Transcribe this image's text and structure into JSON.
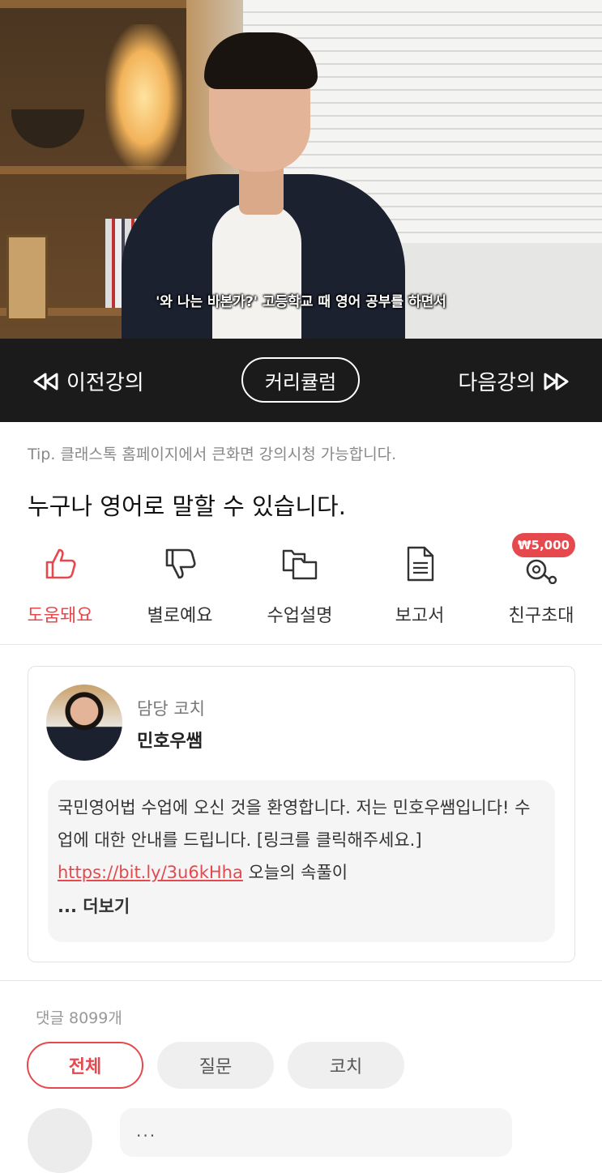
{
  "video": {
    "subtitle": "'와 나는 바본가?' 고등학교 때 영어 공부를 하면서"
  },
  "navbar": {
    "prev_label": "이전강의",
    "curriculum_label": "커리큘럼",
    "next_label": "다음강의"
  },
  "tip": "Tip. 클래스톡 홈페이지에서 큰화면 강의시청 가능합니다.",
  "lesson_title": "누구나 영어로 말할 수 있습니다.",
  "actions": [
    {
      "label": "도움돼요",
      "icon": "thumbs-up-icon"
    },
    {
      "label": "별로예요",
      "icon": "thumbs-down-icon"
    },
    {
      "label": "수업설명",
      "icon": "folders-icon"
    },
    {
      "label": "보고서",
      "icon": "document-icon"
    },
    {
      "label": "친구초대",
      "icon": "invite-icon"
    }
  ],
  "invite_badge": "₩5,000",
  "coach": {
    "role": "담당 코치",
    "name": "민호우쌤",
    "message_before_link": "국민영어법 수업에 오신 것을 환영합니다. 저는 민호우쌤입니다! 수업에 대한 안내를 드립니다. [링크를 클릭해주세요.] ",
    "link": "https://bit.ly/3u6kHha",
    "message_after_link": " 오늘의 속풀이",
    "more_label": "... 더보기"
  },
  "comments": {
    "count_label": "댓글 8099개",
    "filters": [
      "전체",
      "질문",
      "코치"
    ],
    "active_filter": "전체",
    "first_comment_preview": "..."
  },
  "colors": {
    "accent": "#e5484d",
    "navbar_bg": "#1b1b1b"
  }
}
